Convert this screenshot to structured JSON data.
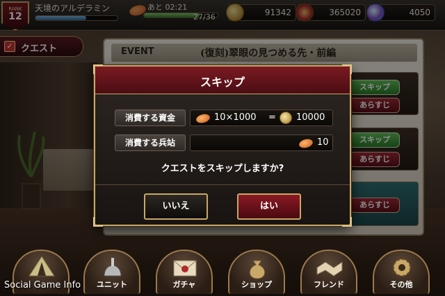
{
  "player": {
    "rank_label": "RANK",
    "rank": "12",
    "name": "天境のアルデラミン",
    "stamina_time": "あと 02:21",
    "stamina_count": "27/36"
  },
  "currencies": {
    "gold": "91342",
    "supply": "365020",
    "gems": "4050"
  },
  "quest_tab": {
    "label": "クエスト"
  },
  "event": {
    "tag": "EVENT",
    "title": "(復刻)翠眼の見つめる先・前編",
    "skip_label": "スキップ",
    "summary_label": "あらすじ"
  },
  "modal": {
    "title": "スキップ",
    "cost_rows": [
      {
        "label": "消費する資金",
        "unit": "10×1000",
        "eq": "=",
        "total": "10000"
      },
      {
        "label": "消費する兵站",
        "total": "10"
      }
    ],
    "confirm": "クエストをスキップしますか?",
    "no_label": "いいえ",
    "yes_label": "はい"
  },
  "nav": [
    {
      "label": ""
    },
    {
      "label": "ユニット"
    },
    {
      "label": "ガチャ"
    },
    {
      "label": "ショップ"
    },
    {
      "label": "フレンド"
    },
    {
      "label": "その他"
    }
  ],
  "watermark": "Social Game Info",
  "colors": {
    "accent_gold": "#c9a866",
    "modal_header": "#7a1a22",
    "button_red": "#8a1a24"
  }
}
